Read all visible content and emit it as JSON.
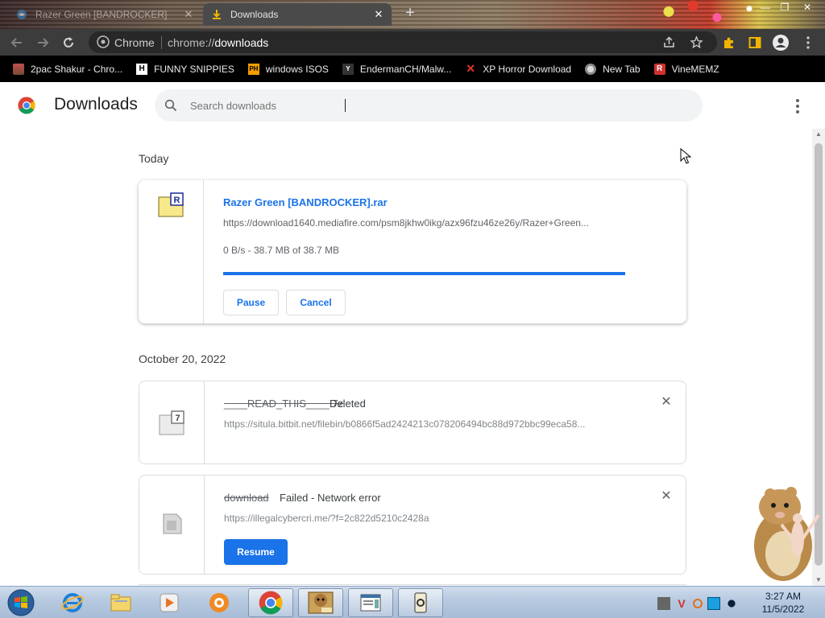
{
  "browser": {
    "tabs": [
      {
        "title": "Razer Green [BANDROCKER]",
        "active": false
      },
      {
        "title": "Downloads",
        "active": true
      }
    ],
    "omnibox": {
      "chip": "Chrome",
      "url_prefix": "chrome://",
      "url_host": "downloads"
    },
    "bookmarks": [
      {
        "label": "2pac Shakur - Chro...",
        "icon": "bookmark-image-icon"
      },
      {
        "label": "FUNNY SNIPPIES",
        "icon": "h-logo-icon"
      },
      {
        "label": "windows ISOS",
        "icon": "ph-logo-icon"
      },
      {
        "label": "EndermanCH/Malw...",
        "icon": "youtube-logo-icon"
      },
      {
        "label": "XP Horror Download",
        "icon": "x-logo-icon"
      },
      {
        "label": "New Tab",
        "icon": "globe-icon"
      },
      {
        "label": "VineMEMZ",
        "icon": "r-logo-icon"
      }
    ]
  },
  "downloads_page": {
    "title": "Downloads",
    "search_placeholder": "Search downloads",
    "groups": [
      {
        "date": "Today",
        "items": [
          {
            "filename": "Razer Green [BANDROCKER].rar",
            "url": "https://download1640.mediafire.com/psm8jkhw0ikg/azx96fzu46ze26y/Razer+Green...",
            "progress_text": "0 B/s - 38.7 MB of 38.7 MB",
            "progress": 1.0,
            "icon": "rar-archive-icon",
            "buttons": [
              "Pause",
              "Cancel"
            ]
          }
        ]
      },
      {
        "date": "October 20, 2022",
        "items": [
          {
            "filename": "____READ_THIS____.7z",
            "status": "Deleted",
            "url": "https://situla.bitbit.net/filebin/b0866f5ad2424213c078206494bc88d972bbc99eca58...",
            "icon": "7z-archive-icon"
          },
          {
            "filename": "download",
            "status": "Failed - Network error",
            "url": "https://illegalcybercri.me/?f=2c822d5210c2428a",
            "icon": "generic-file-icon",
            "button": "Resume"
          }
        ]
      }
    ]
  },
  "taskbar": {
    "time": "3:27 AM",
    "date": "11/5/2022"
  },
  "colors": {
    "accent": "#1a73e8",
    "toolbar": "#3c3c3c",
    "bookmarks_bar": "#000000",
    "taskbar": "#b6c9e0"
  }
}
